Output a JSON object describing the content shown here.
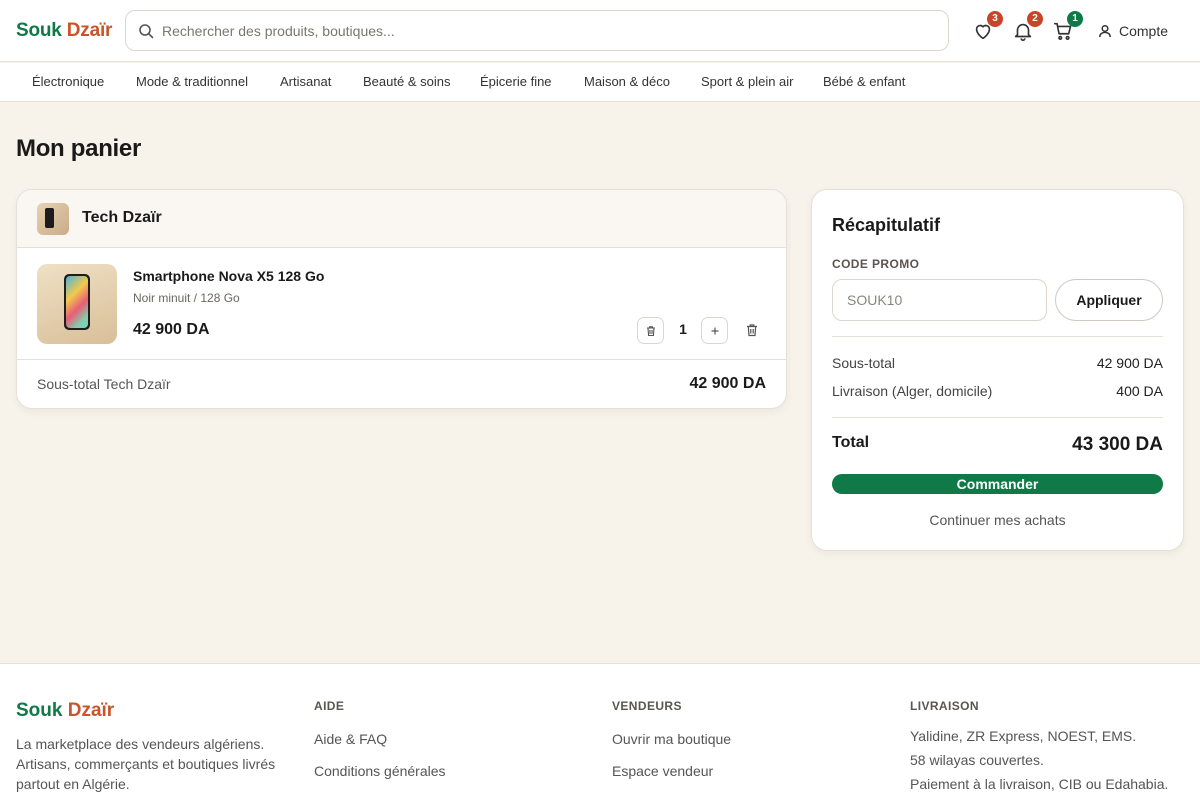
{
  "header": {
    "logo_part1": "Souk",
    "logo_part2": "Dzaïr",
    "search_placeholder": "Rechercher des produits, boutiques...",
    "wishlist_count": "3",
    "notifications_count": "2",
    "cart_count": "1",
    "account_label": "Compte"
  },
  "categories": [
    "Électronique",
    "Mode & traditionnel",
    "Artisanat",
    "Beauté & soins",
    "Épicerie fine",
    "Maison & déco",
    "Sport & plein air",
    "Bébé & enfant"
  ],
  "page_title": "Mon panier",
  "cart": {
    "shop_name": "Tech Dzaïr",
    "item": {
      "name": "Smartphone Nova X5 128 Go",
      "variant": "Noir minuit / 128 Go",
      "price": "42 900 DA",
      "quantity": "1"
    },
    "shop_subtotal_label": "Sous-total Tech Dzaïr",
    "shop_subtotal_value": "42 900 DA"
  },
  "summary": {
    "title": "Récapitulatif",
    "promo_label": "CODE PROMO",
    "promo_placeholder": "SOUK10",
    "apply_label": "Appliquer",
    "subtotal_label": "Sous-total",
    "subtotal_value": "42 900 DA",
    "shipping_label": "Livraison (Alger, domicile)",
    "shipping_value": "400 DA",
    "total_label": "Total",
    "total_value": "43 300 DA",
    "order_label": "Commander",
    "continue_label": "Continuer mes achats"
  },
  "footer": {
    "logo_part1": "Souk",
    "logo_part2": "Dzaïr",
    "description": "La marketplace des vendeurs algériens. Artisans, commerçants et boutiques livrés partout en Algérie.",
    "help_heading": "AIDE",
    "help_links": [
      "Aide & FAQ",
      "Conditions générales"
    ],
    "vendors_heading": "VENDEURS",
    "vendors_links": [
      "Ouvrir ma boutique",
      "Espace vendeur"
    ],
    "delivery_heading": "LIVRAISON",
    "delivery_lines": [
      "Yalidine, ZR Express, NOEST, EMS.",
      "58 wilayas couvertes.",
      "Paiement à la livraison, CIB ou Edahabia."
    ]
  },
  "colors": {
    "brand_green": "#0f7a47",
    "brand_orange": "#c8552a",
    "badge_red": "#c8452a",
    "page_bg": "#f7f2ea"
  }
}
